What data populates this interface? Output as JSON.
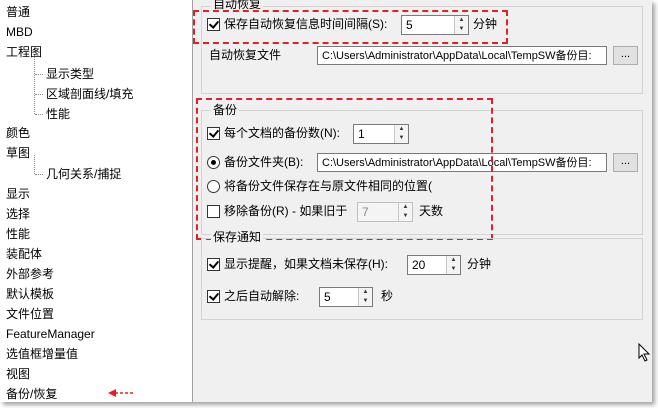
{
  "tree": {
    "items": [
      {
        "label": "普通",
        "level": 0
      },
      {
        "label": "MBD",
        "level": 0
      },
      {
        "label": "工程图",
        "level": 0
      },
      {
        "label": "显示类型",
        "level": 1
      },
      {
        "label": "区域剖面线/填充",
        "level": 1
      },
      {
        "label": "性能",
        "level": 1
      },
      {
        "label": "颜色",
        "level": 0
      },
      {
        "label": "草图",
        "level": 0
      },
      {
        "label": "几何关系/捕捉",
        "level": 1
      },
      {
        "label": "显示",
        "level": 0
      },
      {
        "label": "选择",
        "level": 0
      },
      {
        "label": "性能",
        "level": 0
      },
      {
        "label": "装配体",
        "level": 0
      },
      {
        "label": "外部参考",
        "level": 0
      },
      {
        "label": "默认模板",
        "level": 0
      },
      {
        "label": "文件位置",
        "level": 0
      },
      {
        "label": "FeatureManager",
        "level": 0
      },
      {
        "label": "选值框增量值",
        "level": 0
      },
      {
        "label": "视图",
        "level": 0
      },
      {
        "label": "备份/恢复",
        "level": 0,
        "selected": true
      }
    ]
  },
  "auto_recover": {
    "title": "自动恢复",
    "save_info_label": "保存自动恢复信息时间间隔(S):",
    "save_info_checked": true,
    "interval_value": "5",
    "interval_unit": "分钟",
    "folder_label": "自动恢复文件",
    "folder_path": "C:\\Users\\Administrator\\AppData\\Local\\TempSW备份目:",
    "browse_label": "..."
  },
  "backup": {
    "title": "备份",
    "backups_per_doc_label": "每个文档的备份数(N):",
    "backups_per_doc_checked": true,
    "backups_per_doc_value": "1",
    "backup_folder_label": "备份文件夹(B):",
    "backup_folder_selected": true,
    "backup_folder_path": "C:\\Users\\Administrator\\AppData\\Local\\TempSW备份目:",
    "browse_label": "...",
    "same_location_label": "将备份文件保存在与原文件相同的位置(",
    "same_location_selected": false,
    "remove_label": "移除备份(R) - 如果旧于",
    "remove_checked": false,
    "remove_value": "7",
    "remove_unit": "天数"
  },
  "save_notify": {
    "title": "保存通知",
    "show_reminder_label": "显示提醒，如果文档未保存(H):",
    "show_reminder_checked": true,
    "reminder_value": "20",
    "reminder_unit": "分钟",
    "auto_dismiss_label": "之后自动解除:",
    "auto_dismiss_checked": true,
    "dismiss_value": "5",
    "dismiss_unit": "秒"
  },
  "colors": {
    "highlight_dash": "#e0202a",
    "panel_bg": "#f0f0f0"
  }
}
